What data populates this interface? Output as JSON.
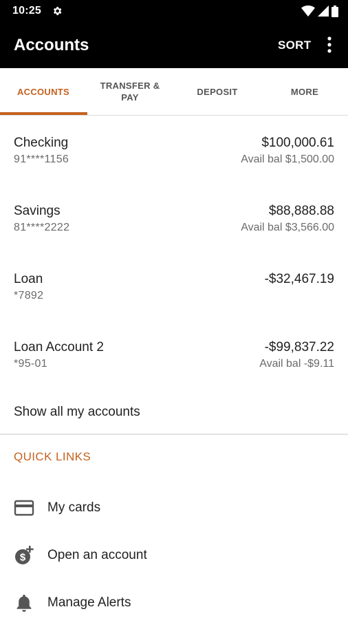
{
  "status_bar": {
    "time": "10:25",
    "icons": [
      "settings-icon",
      "wifi-icon",
      "signal-icon",
      "battery-icon"
    ]
  },
  "app_bar": {
    "title": "Accounts",
    "sort_label": "SORT",
    "overflow_icon": "more-vert-icon"
  },
  "tabs": [
    {
      "label": "ACCOUNTS",
      "active": true
    },
    {
      "label": "TRANSFER & PAY",
      "active": false
    },
    {
      "label": "DEPOSIT",
      "active": false
    },
    {
      "label": "MORE",
      "active": false
    }
  ],
  "accounts": [
    {
      "name": "Checking",
      "number": "91****1156",
      "balance": "$100,000.61",
      "available": "Avail bal $1,500.00"
    },
    {
      "name": "Savings",
      "number": "81****2222",
      "balance": "$88,888.88",
      "available": "Avail bal $3,566.00"
    },
    {
      "name": "Loan",
      "number": "*7892",
      "balance": "-$32,467.19",
      "available": ""
    },
    {
      "name": "Loan Account 2",
      "number": "*95-01",
      "balance": "-$99,837.22",
      "available": "Avail bal -$9.11"
    }
  ],
  "show_all_label": "Show all my accounts",
  "quick_links": {
    "heading": "QUICK LINKS",
    "items": [
      {
        "label": "My cards",
        "icon": "credit-card-icon"
      },
      {
        "label": "Open an account",
        "icon": "add-money-icon"
      },
      {
        "label": "Manage Alerts",
        "icon": "bell-icon"
      }
    ]
  },
  "colors": {
    "accent": "#c4611f",
    "app_bar_bg": "#000000",
    "text_primary": "#212121",
    "text_secondary": "#6a6a6a"
  }
}
